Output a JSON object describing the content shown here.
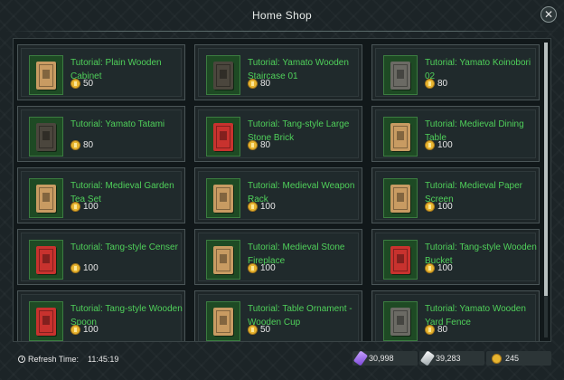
{
  "window": {
    "title": "Home Shop",
    "close_symbol": "✕"
  },
  "items": [
    {
      "name": "Tutorial: Plain Wooden Cabinet",
      "price": "50",
      "icon": "book-tan-icon"
    },
    {
      "name": "Tutorial: Yamato Wooden Staircase 01",
      "price": "80",
      "icon": "book-dark-icon"
    },
    {
      "name": "Tutorial: Yamato Koinobori 02",
      "price": "80",
      "icon": "book-grey-icon"
    },
    {
      "name": "Tutorial: Yamato Tatami",
      "price": "80",
      "icon": "book-dark-icon"
    },
    {
      "name": "Tutorial: Tang-style Large Stone Brick",
      "price": "80",
      "icon": "book-red-icon"
    },
    {
      "name": "Tutorial: Medieval Dining Table",
      "price": "100",
      "icon": "book-tan-icon"
    },
    {
      "name": "Tutorial: Medieval Garden Tea Set",
      "price": "100",
      "icon": "book-tan-icon"
    },
    {
      "name": "Tutorial: Medieval Weapon Rack",
      "price": "100",
      "icon": "book-tan-icon"
    },
    {
      "name": "Tutorial: Medieval Paper Screen",
      "price": "100",
      "icon": "book-tan-icon"
    },
    {
      "name": "Tutorial: Tang-style Censer",
      "price": "100",
      "icon": "book-red-icon"
    },
    {
      "name": "Tutorial: Medieval Stone Fireplace",
      "price": "100",
      "icon": "book-tan-icon"
    },
    {
      "name": "Tutorial: Tang-style Wooden Bucket",
      "price": "100",
      "icon": "book-red-icon"
    },
    {
      "name": "Tutorial: Tang-style Wooden Spoon",
      "price": "100",
      "icon": "book-red-icon"
    },
    {
      "name": "Tutorial: Table Ornament - Wooden Cup",
      "price": "50",
      "icon": "book-tan-icon"
    },
    {
      "name": "Tutorial: Yamato Wooden Yard Fence",
      "price": "80",
      "icon": "book-grey-icon"
    }
  ],
  "footer": {
    "refresh_label": "Refresh Time:",
    "refresh_time": "11:45:19",
    "currencies": [
      {
        "value": "30,998",
        "icon": "purple-gem-icon"
      },
      {
        "value": "39,283",
        "icon": "silver-crystal-icon"
      },
      {
        "value": "245",
        "icon": "gold-coin-icon"
      }
    ]
  },
  "colors": {
    "item_name": "#4fd05a",
    "thumb_bg": "#1e4a24",
    "coin": "#e8b530"
  },
  "scroll": {
    "visible_fraction": 0.86
  }
}
